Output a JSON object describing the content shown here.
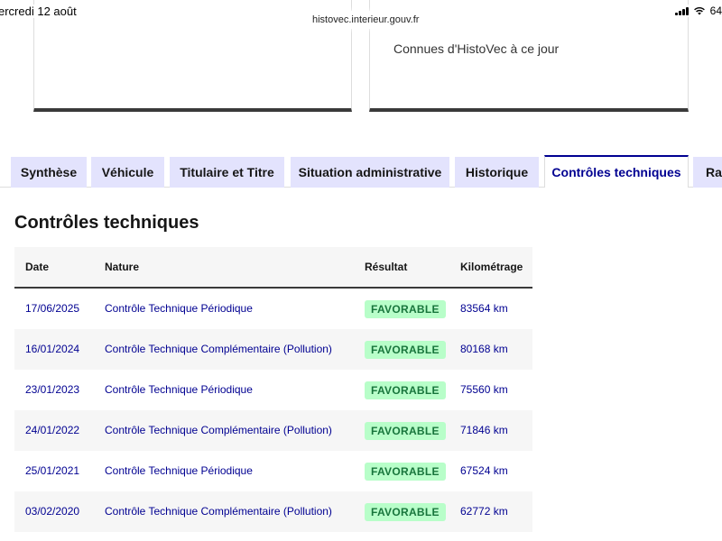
{
  "status_bar": {
    "date": "ercredi 12 août",
    "battery": "64",
    "url": "histovec.interieur.gouv.fr"
  },
  "cards": {
    "right_text": "Connues d'HistoVec à ce jour"
  },
  "tabs": [
    {
      "label": "Synthèse",
      "active": false
    },
    {
      "label": "Véhicule",
      "active": false
    },
    {
      "label": "Titulaire et Titre",
      "active": false
    },
    {
      "label": "Situation administrative",
      "active": false
    },
    {
      "label": "Historique",
      "active": false
    },
    {
      "label": "Contrôles techniques",
      "active": true
    },
    {
      "label": "Rap",
      "active": false
    }
  ],
  "section": {
    "title": "Contrôles techniques"
  },
  "table": {
    "headers": {
      "date": "Date",
      "nature": "Nature",
      "result": "Résultat",
      "km": "Kilométrage"
    },
    "rows": [
      {
        "date": "17/06/2025",
        "nature": "Contrôle Technique Périodique",
        "result": "FAVORABLE",
        "km": "83564 km"
      },
      {
        "date": "16/01/2024",
        "nature": "Contrôle Technique Complémentaire (Pollution)",
        "result": "FAVORABLE",
        "km": "80168 km"
      },
      {
        "date": "23/01/2023",
        "nature": "Contrôle Technique Périodique",
        "result": "FAVORABLE",
        "km": "75560 km"
      },
      {
        "date": "24/01/2022",
        "nature": "Contrôle Technique Complémentaire (Pollution)",
        "result": "FAVORABLE",
        "km": "71846 km"
      },
      {
        "date": "25/01/2021",
        "nature": "Contrôle Technique Périodique",
        "result": "FAVORABLE",
        "km": "67524 km"
      },
      {
        "date": "03/02/2020",
        "nature": "Contrôle Technique Complémentaire (Pollution)",
        "result": "FAVORABLE",
        "km": "62772 km"
      }
    ]
  },
  "colors": {
    "accent": "#000091",
    "tab_bg": "#e3e3fd",
    "badge_bg": "#b8fec9",
    "badge_text": "#18753c"
  },
  "icons": {
    "signal": "cellular-signal-icon",
    "wifi": "wifi-icon"
  }
}
